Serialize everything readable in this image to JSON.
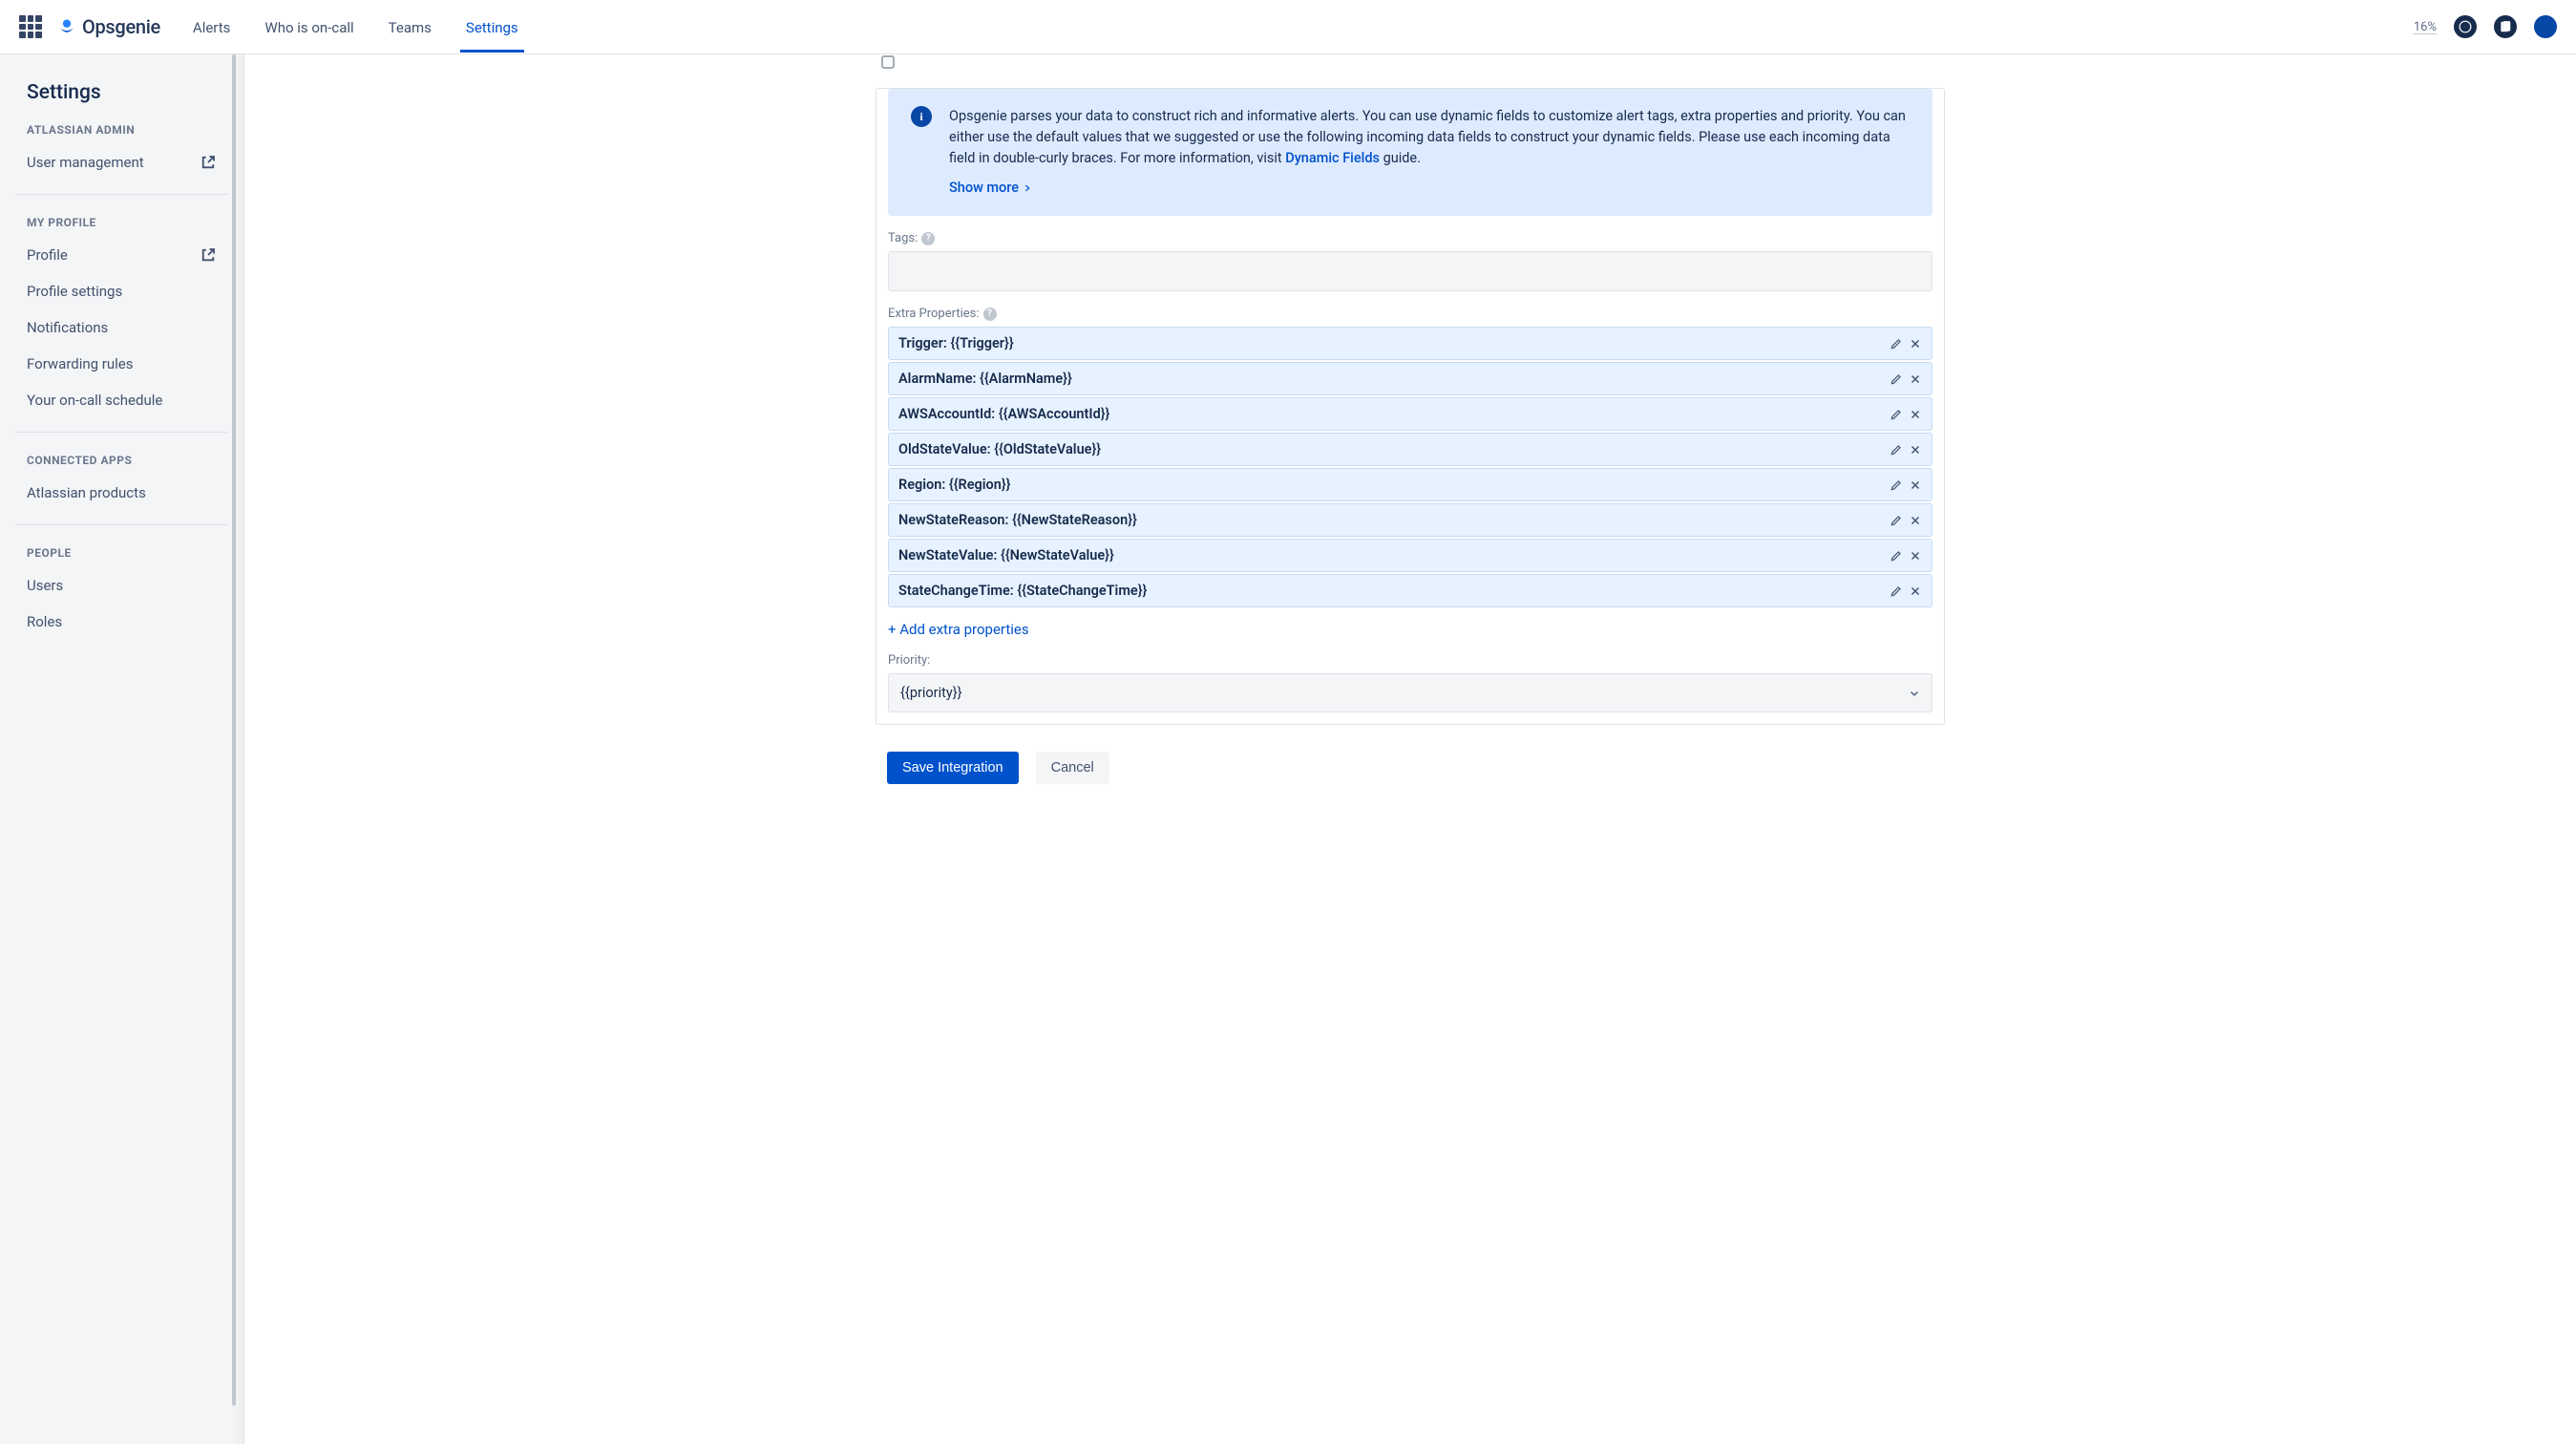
{
  "header": {
    "brand": "Opsgenie",
    "nav": {
      "alerts": "Alerts",
      "whoOnCall": "Who is on-call",
      "teams": "Teams",
      "settings": "Settings"
    },
    "percent": "16%"
  },
  "sidebar": {
    "title": "Settings",
    "atlassianAdmin": {
      "head": "ATLASSIAN ADMIN",
      "userManagement": "User management"
    },
    "myProfile": {
      "head": "MY PROFILE",
      "profile": "Profile",
      "profileSettings": "Profile settings",
      "notifications": "Notifications",
      "forwardingRules": "Forwarding rules",
      "schedule": "Your on-call schedule"
    },
    "connectedApps": {
      "head": "CONNECTED APPS",
      "atlassianProducts": "Atlassian products"
    },
    "people": {
      "head": "PEOPLE",
      "users": "Users",
      "roles": "Roles"
    }
  },
  "main": {
    "info": {
      "text_prefix": "Opsgenie parses your data to construct rich and informative alerts. You can use dynamic fields to customize alert tags, extra properties and priority. You can either use the default values that we suggested or use the following incoming data fields to construct your dynamic fields. Please use each incoming data field in double-curly braces. For more information, visit ",
      "link": "Dynamic Fields",
      "text_suffix": " guide.",
      "showMore": "Show more"
    },
    "tagsLabel": "Tags:",
    "extraPropsLabel": "Extra Properties:",
    "properties": [
      "Trigger: {{Trigger}}",
      "AlarmName: {{AlarmName}}",
      "AWSAccountId: {{AWSAccountId}}",
      "OldStateValue: {{OldStateValue}}",
      "Region: {{Region}}",
      "NewStateReason: {{NewStateReason}}",
      "NewStateValue: {{NewStateValue}}",
      "StateChangeTime: {{StateChangeTime}}"
    ],
    "addExtra": "+ Add extra properties",
    "priorityLabel": "Priority:",
    "priorityValue": "{{priority}}",
    "save": "Save Integration",
    "cancel": "Cancel"
  }
}
